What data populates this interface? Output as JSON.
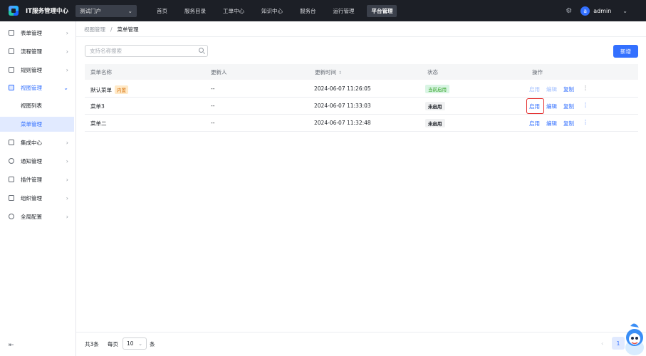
{
  "header": {
    "app_title": "IT服务管理中心",
    "portal_selected": "测试门户",
    "nav": [
      "首页",
      "服务目录",
      "工单中心",
      "知识中心",
      "服务台",
      "运行管理",
      "平台管理"
    ],
    "active_nav": "平台管理",
    "user_initial": "a",
    "user_name": "admin"
  },
  "sidebar": {
    "items": [
      "表单管理",
      "流程管理",
      "规则管理",
      "视图管理",
      "集成中心",
      "通知管理",
      "插件管理",
      "组织管理",
      "全局配置"
    ],
    "sub_items": [
      "视图列表",
      "菜单管理"
    ],
    "active_sub": "菜单管理"
  },
  "breadcrumb": {
    "parent": "视图管理",
    "separator": "/",
    "current": "菜单管理"
  },
  "search": {
    "placeholder": "支持名称搜索",
    "value": ""
  },
  "toolbar": {
    "new_label": "新增"
  },
  "table": {
    "columns": [
      "菜单名称",
      "更新人",
      "更新时间",
      "状态",
      "操作"
    ],
    "sort_icon": "⇕",
    "rows": [
      {
        "name": "默认菜单",
        "tag": "内置",
        "updater": "--",
        "time": "2024-06-07 11:26:05",
        "status": "当前启用",
        "actions": [
          "启用",
          "编辑",
          "复制"
        ],
        "more": "⋮"
      },
      {
        "name": "菜单3",
        "tag": "",
        "updater": "--",
        "time": "2024-06-07 11:33:03",
        "status": "未启用",
        "actions": [
          "启用",
          "编辑",
          "复制"
        ],
        "more": "⋮"
      },
      {
        "name": "菜单二",
        "tag": "",
        "updater": "--",
        "time": "2024-06-07 11:32:48",
        "status": "未启用",
        "actions": [
          "启用",
          "编辑",
          "复制"
        ],
        "more": "⋮"
      }
    ]
  },
  "pagination": {
    "total": "共3条",
    "per_page_label": "每页",
    "page_size": "10",
    "unit": "条",
    "prev": "‹",
    "current_page": "1"
  },
  "colors": {
    "primary": "#3370ff",
    "topbar": "#1c1f26",
    "highlight": "#e22323"
  }
}
